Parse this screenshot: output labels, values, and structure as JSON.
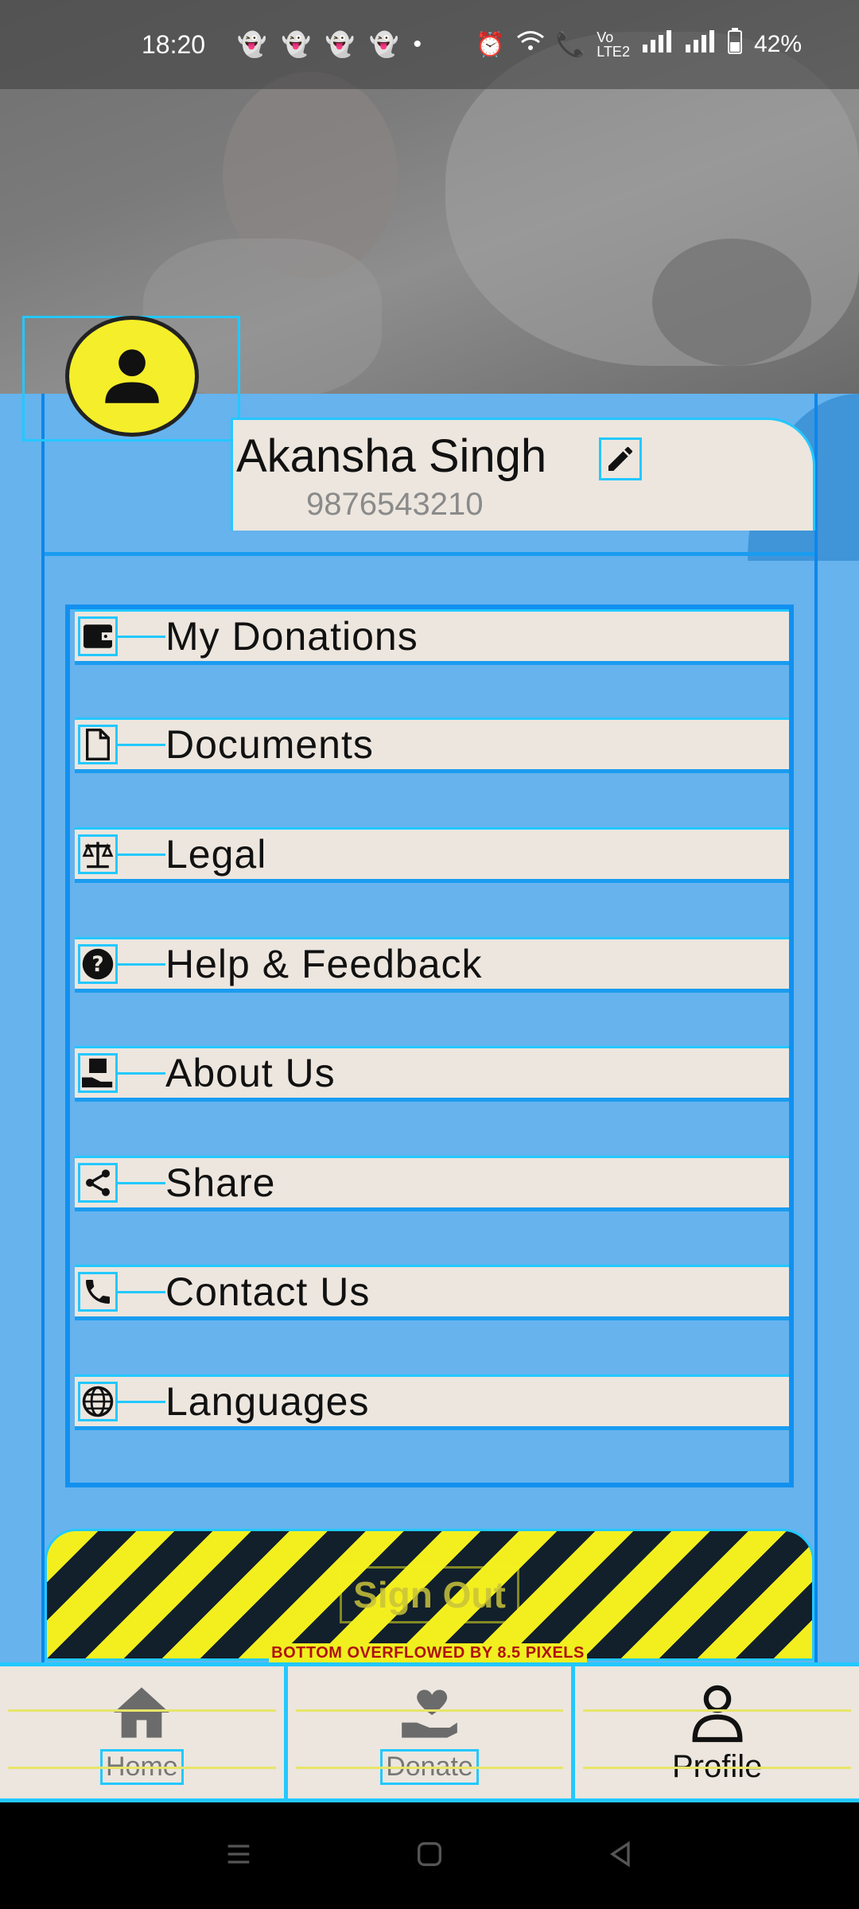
{
  "status_bar": {
    "time": "18:20",
    "battery": "42%",
    "icons": [
      "snapchat-icon",
      "snapchat-icon",
      "snapchat-icon",
      "snapchat-icon",
      "dot-icon",
      "alarm-icon",
      "wifi-icon",
      "wifi-call-icon",
      "volte-icon",
      "signal-icon",
      "signal-icon",
      "battery-icon"
    ]
  },
  "profile": {
    "name": "Akansha Singh",
    "phone": "9876543210"
  },
  "menu": [
    {
      "label": "My Donations",
      "icon": "wallet-icon"
    },
    {
      "label": "Documents",
      "icon": "document-icon"
    },
    {
      "label": "Legal",
      "icon": "scale-icon"
    },
    {
      "label": "Help & Feedback",
      "icon": "help-icon"
    },
    {
      "label": "About Us",
      "icon": "about-icon"
    },
    {
      "label": "Share",
      "icon": "share-icon"
    },
    {
      "label": "Contact Us",
      "icon": "phone-icon"
    },
    {
      "label": "Languages",
      "icon": "globe-icon"
    }
  ],
  "sign_out": {
    "label": "Sign Out"
  },
  "overflow_message": "BOTTOM OVERFLOWED BY 8.5 PIXELS",
  "bottom_nav": [
    {
      "label": "Home",
      "icon": "home-icon"
    },
    {
      "label": "Donate",
      "icon": "donate-icon"
    },
    {
      "label": "Profile",
      "icon": "profile-icon"
    }
  ],
  "colors": {
    "panel": "#66b3ee",
    "card": "#ece6de",
    "avatar": "#f5ee2a",
    "debug_outline": "#23c8ff"
  }
}
